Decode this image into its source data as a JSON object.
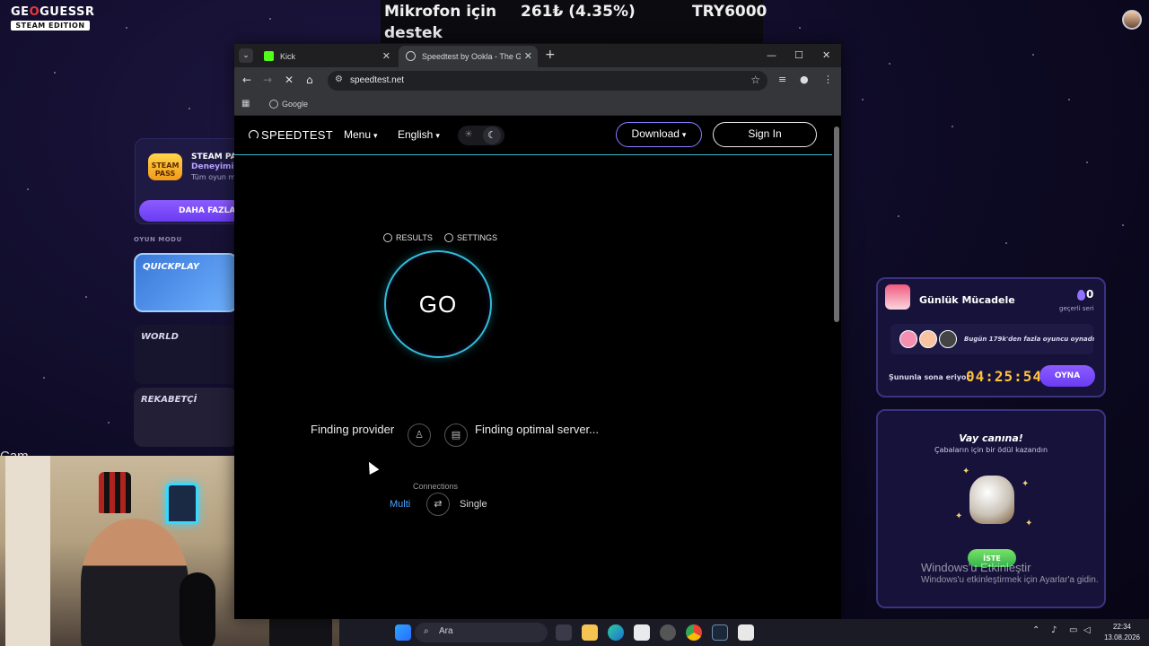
{
  "overlay": {
    "logo": {
      "line1_a": "GE",
      "line1_b": "O",
      "line1_c": "GUESSR",
      "line2": "STEAM EDITION"
    },
    "ticker": {
      "text1": "Mikrofon için",
      "text2": "destek",
      "amount": "261₺ (4.35%)",
      "goal": "TRY6000"
    },
    "cam_label": "Cam"
  },
  "game": {
    "steam_pass": {
      "logo": "STEAM PASS",
      "title": "STEAM PASS",
      "subtitle": "Deneyimini",
      "desc": "Tüm oyun mo",
      "button": "DAHA FAZLA B"
    },
    "mode_label": "OYUN MODU",
    "modes": [
      "QUICKPLAY",
      "WORLD",
      "REKABETÇİ"
    ],
    "daily": {
      "title": "Günlük Mücadele",
      "streak_count": "0",
      "streak_label": "geçerli seri",
      "players_text": "Bugün 179k'den fazla oyuncu oynadı",
      "ends_label": "Şununla sona eriyor",
      "timer": "04:25:54",
      "play_button": "OYNA"
    },
    "reward": {
      "title": "Vay canına!",
      "subtitle": "Çabaların için bir ödül kazandın",
      "button": "İSTE"
    }
  },
  "windows": {
    "activate_title": "Windows'u Etkinleştir",
    "activate_sub": "Windows'u etkinleştirmek için Ayarlar'a gidin.",
    "search_placeholder": "Ara",
    "time": "22:34",
    "date": "13.08.2026"
  },
  "browser": {
    "tabs": [
      {
        "label": "Kick",
        "active": false
      },
      {
        "label": "Speedtest by Ookla - The Global",
        "active": true
      }
    ],
    "url": "speedtest.net",
    "bookmark": "Google"
  },
  "speedtest": {
    "logo": "SPEEDTEST",
    "menu": "Menu",
    "language": "English",
    "download_button": "Download",
    "signin_button": "Sign In",
    "results": "RESULTS",
    "settings": "SETTINGS",
    "go": "GO",
    "provider_status": "Finding provider",
    "server_status": "Finding optimal server...",
    "connections_label": "Connections",
    "connections_multi": "Multi",
    "connections_single": "Single"
  },
  "colors": {
    "accent_cyan": "#2fbfd6",
    "accent_purple": "#8b7dff",
    "multi_blue": "#4aa3ff",
    "timer_gold": "#ffc43a"
  },
  "icons": {
    "tab_menu": "chevron-down-icon",
    "back": "arrow-left-icon",
    "forward": "arrow-right-icon",
    "reload": "reload-icon",
    "home": "home-icon",
    "bookmark": "star-icon",
    "theme_light": "sun-icon",
    "theme_dark": "moon-icon",
    "provider": "person-icon",
    "server": "server-icon"
  }
}
